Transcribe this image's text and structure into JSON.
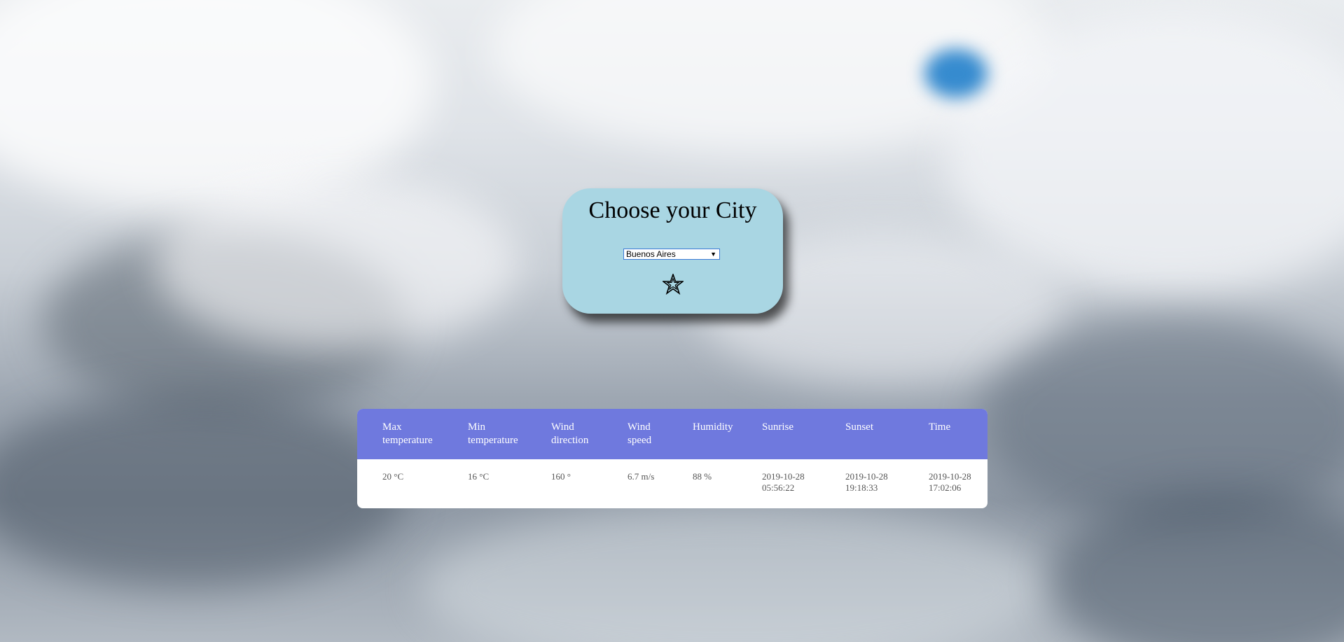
{
  "card": {
    "title": "Choose your City",
    "city_select": {
      "selected": "Buenos Aires"
    },
    "star_icon": "star-icon"
  },
  "weather_table": {
    "headers": [
      "Max temperature",
      "Min temperature",
      "Wind direction",
      "Wind speed",
      "Humidity",
      "Sunrise",
      "Sunset",
      "Time"
    ],
    "row": {
      "max_temperature": "20 °C",
      "min_temperature": "16 °C",
      "wind_direction": "160 °",
      "wind_speed": "6.7 m/s",
      "humidity": "88 %",
      "sunrise_date": "2019-10-28",
      "sunrise_time": "05:56:22",
      "sunset_date": "2019-10-28",
      "sunset_time": "19:18:33",
      "time_date": "2019-10-28",
      "time_time": "17:02:06"
    }
  },
  "colors": {
    "card_background": "#a9d6e3",
    "table_header": "#6f79de",
    "select_border": "#3d7bd6"
  }
}
